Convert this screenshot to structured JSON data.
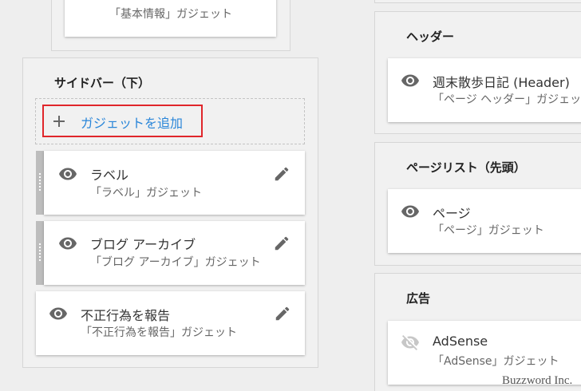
{
  "top_card": {
    "subtitle": "「基本情報」ガジェット"
  },
  "sidebar_bottom": {
    "title": "サイドバー（下）",
    "add_gadget_label": "ガジェットを追加",
    "gadgets": [
      {
        "title": "ラベル",
        "subtitle": "「ラベル」ガジェット"
      },
      {
        "title": "ブログ アーカイブ",
        "subtitle": "「ブログ アーカイブ」ガジェット"
      },
      {
        "title": "不正行為を報告",
        "subtitle": "「不正行為を報告」ガジェット"
      }
    ]
  },
  "header_section": {
    "title": "ヘッダー",
    "gadget": {
      "title": "週末散歩日記 (Header)",
      "subtitle": "「ページ ヘッダー」ガジェット"
    }
  },
  "pagelist_section": {
    "title": "ページリスト（先頭）",
    "gadget": {
      "title": "ページ",
      "subtitle": "「ページ」ガジェット"
    }
  },
  "ads_section": {
    "title": "広告",
    "gadget": {
      "title": "AdSense",
      "subtitle": "「AdSense」ガジェット"
    }
  },
  "watermark": "Buzzword Inc.",
  "colors": {
    "background": "#eeeeee",
    "link_blue": "#2a86d9",
    "highlight_red": "#e0262b",
    "drag_handle": "#bdbdbd"
  }
}
